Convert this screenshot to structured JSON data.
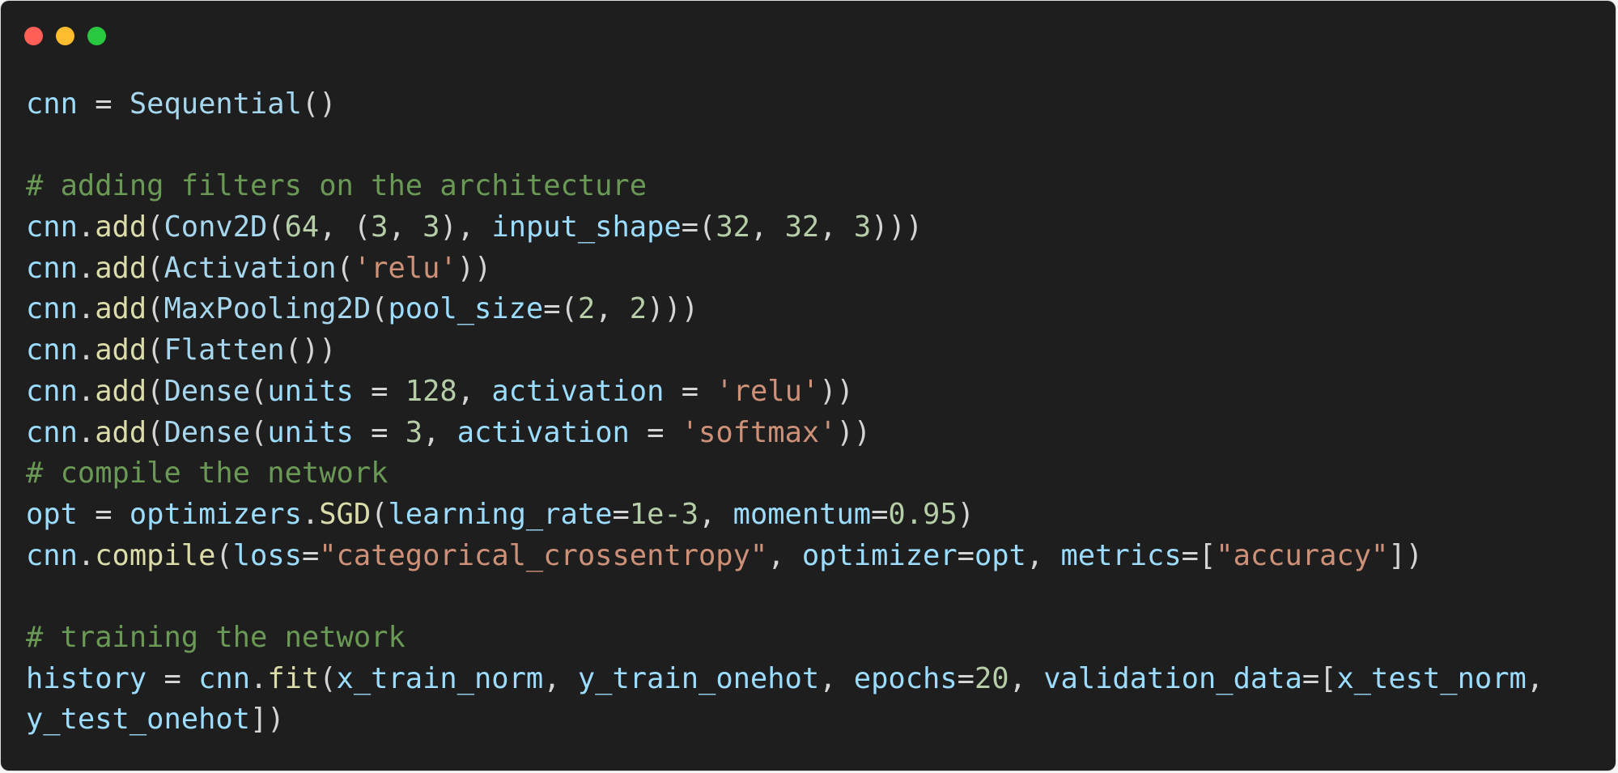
{
  "window": {
    "controls": [
      {
        "name": "close",
        "color": "#ff5f57"
      },
      {
        "name": "minimize",
        "color": "#febc2e"
      },
      {
        "name": "zoom",
        "color": "#28c840"
      }
    ]
  },
  "code": {
    "language": "python",
    "lines": [
      [
        {
          "t": "cnn",
          "c": "var"
        },
        {
          "t": " = ",
          "c": "p"
        },
        {
          "t": "Sequential",
          "c": "call"
        },
        {
          "t": "()",
          "c": "p"
        }
      ],
      [],
      [
        {
          "t": "# adding filters on the architecture",
          "c": "com"
        }
      ],
      [
        {
          "t": "cnn",
          "c": "var"
        },
        {
          "t": ".",
          "c": "p"
        },
        {
          "t": "add",
          "c": "fn"
        },
        {
          "t": "(",
          "c": "p"
        },
        {
          "t": "Conv2D",
          "c": "call"
        },
        {
          "t": "(",
          "c": "p"
        },
        {
          "t": "64",
          "c": "num"
        },
        {
          "t": ", (",
          "c": "p"
        },
        {
          "t": "3",
          "c": "num"
        },
        {
          "t": ", ",
          "c": "p"
        },
        {
          "t": "3",
          "c": "num"
        },
        {
          "t": "), ",
          "c": "p"
        },
        {
          "t": "input_shape",
          "c": "var"
        },
        {
          "t": "=(",
          "c": "p"
        },
        {
          "t": "32",
          "c": "num"
        },
        {
          "t": ", ",
          "c": "p"
        },
        {
          "t": "32",
          "c": "num"
        },
        {
          "t": ", ",
          "c": "p"
        },
        {
          "t": "3",
          "c": "num"
        },
        {
          "t": ")))",
          "c": "p"
        }
      ],
      [
        {
          "t": "cnn",
          "c": "var"
        },
        {
          "t": ".",
          "c": "p"
        },
        {
          "t": "add",
          "c": "fn"
        },
        {
          "t": "(",
          "c": "p"
        },
        {
          "t": "Activation",
          "c": "call"
        },
        {
          "t": "(",
          "c": "p"
        },
        {
          "t": "'relu'",
          "c": "str"
        },
        {
          "t": "))",
          "c": "p"
        }
      ],
      [
        {
          "t": "cnn",
          "c": "var"
        },
        {
          "t": ".",
          "c": "p"
        },
        {
          "t": "add",
          "c": "fn"
        },
        {
          "t": "(",
          "c": "p"
        },
        {
          "t": "MaxPooling2D",
          "c": "call"
        },
        {
          "t": "(",
          "c": "p"
        },
        {
          "t": "pool_size",
          "c": "var"
        },
        {
          "t": "=(",
          "c": "p"
        },
        {
          "t": "2",
          "c": "num"
        },
        {
          "t": ", ",
          "c": "p"
        },
        {
          "t": "2",
          "c": "num"
        },
        {
          "t": ")))",
          "c": "p"
        }
      ],
      [
        {
          "t": "cnn",
          "c": "var"
        },
        {
          "t": ".",
          "c": "p"
        },
        {
          "t": "add",
          "c": "fn"
        },
        {
          "t": "(",
          "c": "p"
        },
        {
          "t": "Flatten",
          "c": "call"
        },
        {
          "t": "())",
          "c": "p"
        }
      ],
      [
        {
          "t": "cnn",
          "c": "var"
        },
        {
          "t": ".",
          "c": "p"
        },
        {
          "t": "add",
          "c": "fn"
        },
        {
          "t": "(",
          "c": "p"
        },
        {
          "t": "Dense",
          "c": "call"
        },
        {
          "t": "(",
          "c": "p"
        },
        {
          "t": "units",
          "c": "var"
        },
        {
          "t": " = ",
          "c": "p"
        },
        {
          "t": "128",
          "c": "num"
        },
        {
          "t": ", ",
          "c": "p"
        },
        {
          "t": "activation",
          "c": "var"
        },
        {
          "t": " = ",
          "c": "p"
        },
        {
          "t": "'relu'",
          "c": "str"
        },
        {
          "t": "))",
          "c": "p"
        }
      ],
      [
        {
          "t": "cnn",
          "c": "var"
        },
        {
          "t": ".",
          "c": "p"
        },
        {
          "t": "add",
          "c": "fn"
        },
        {
          "t": "(",
          "c": "p"
        },
        {
          "t": "Dense",
          "c": "call"
        },
        {
          "t": "(",
          "c": "p"
        },
        {
          "t": "units",
          "c": "var"
        },
        {
          "t": " = ",
          "c": "p"
        },
        {
          "t": "3",
          "c": "num"
        },
        {
          "t": ", ",
          "c": "p"
        },
        {
          "t": "activation",
          "c": "var"
        },
        {
          "t": " = ",
          "c": "p"
        },
        {
          "t": "'softmax'",
          "c": "str"
        },
        {
          "t": "))",
          "c": "p"
        }
      ],
      [
        {
          "t": "# compile the network",
          "c": "com"
        }
      ],
      [
        {
          "t": "opt",
          "c": "var"
        },
        {
          "t": " = ",
          "c": "p"
        },
        {
          "t": "optimizers",
          "c": "var"
        },
        {
          "t": ".",
          "c": "p"
        },
        {
          "t": "SGD",
          "c": "fn"
        },
        {
          "t": "(",
          "c": "p"
        },
        {
          "t": "learning_rate",
          "c": "var"
        },
        {
          "t": "=",
          "c": "p"
        },
        {
          "t": "1e-3",
          "c": "num"
        },
        {
          "t": ", ",
          "c": "p"
        },
        {
          "t": "momentum",
          "c": "var"
        },
        {
          "t": "=",
          "c": "p"
        },
        {
          "t": "0.95",
          "c": "num"
        },
        {
          "t": ")",
          "c": "p"
        }
      ],
      [
        {
          "t": "cnn",
          "c": "var"
        },
        {
          "t": ".",
          "c": "p"
        },
        {
          "t": "compile",
          "c": "fn"
        },
        {
          "t": "(",
          "c": "p"
        },
        {
          "t": "loss",
          "c": "var"
        },
        {
          "t": "=",
          "c": "p"
        },
        {
          "t": "\"categorical_crossentropy\"",
          "c": "str"
        },
        {
          "t": ", ",
          "c": "p"
        },
        {
          "t": "optimizer",
          "c": "var"
        },
        {
          "t": "=",
          "c": "p"
        },
        {
          "t": "opt",
          "c": "var"
        },
        {
          "t": ", ",
          "c": "p"
        },
        {
          "t": "metrics",
          "c": "var"
        },
        {
          "t": "=[",
          "c": "p"
        },
        {
          "t": "\"accuracy\"",
          "c": "str"
        },
        {
          "t": "])",
          "c": "p"
        }
      ],
      [],
      [
        {
          "t": "# training the network",
          "c": "com"
        }
      ],
      [
        {
          "t": "history",
          "c": "var"
        },
        {
          "t": " = ",
          "c": "p"
        },
        {
          "t": "cnn",
          "c": "var"
        },
        {
          "t": ".",
          "c": "p"
        },
        {
          "t": "fit",
          "c": "fn"
        },
        {
          "t": "(",
          "c": "p"
        },
        {
          "t": "x_train_norm",
          "c": "var"
        },
        {
          "t": ", ",
          "c": "p"
        },
        {
          "t": "y_train_onehot",
          "c": "var"
        },
        {
          "t": ", ",
          "c": "p"
        },
        {
          "t": "epochs",
          "c": "var"
        },
        {
          "t": "=",
          "c": "p"
        },
        {
          "t": "20",
          "c": "num"
        },
        {
          "t": ", ",
          "c": "p"
        },
        {
          "t": "validation_data",
          "c": "var"
        },
        {
          "t": "=[",
          "c": "p"
        },
        {
          "t": "x_test_norm",
          "c": "var"
        },
        {
          "t": ",",
          "c": "p"
        }
      ],
      [
        {
          "t": "y_test_onehot",
          "c": "var"
        },
        {
          "t": "])",
          "c": "p"
        }
      ]
    ]
  }
}
